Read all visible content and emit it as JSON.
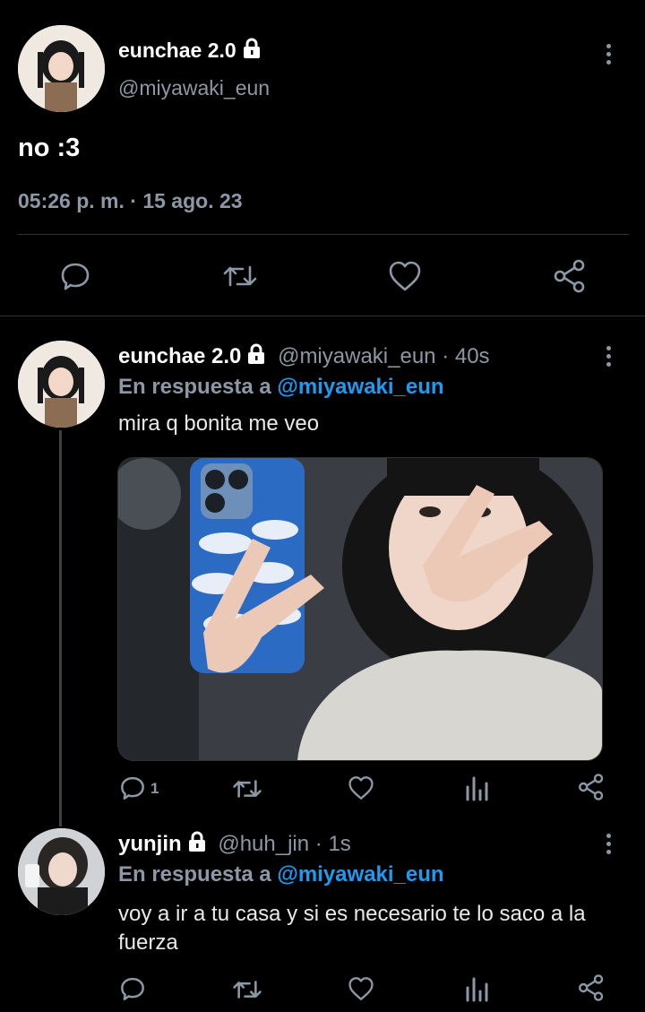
{
  "main_tweet": {
    "display_name": "eunchae 2.0",
    "handle": "@miyawaki_eun",
    "text": "no :3",
    "timestamp": "05:26 p. m. · 15 ago. 23"
  },
  "replies": [
    {
      "display_name": "eunchae 2.0",
      "handle": "@miyawaki_eun",
      "time": "· 40s",
      "reply_prefix": "En respuesta a",
      "reply_to": "@miyawaki_eun",
      "text": "mira q bonita me veo",
      "reply_count": "1",
      "has_image": true
    },
    {
      "display_name": "yunjin",
      "handle": "@huh_jin",
      "time": "· 1s",
      "reply_prefix": "En respuesta a",
      "reply_to": "@miyawaki_eun",
      "text": "voy a ir a tu casa y si es necesario te lo saco a la fuerza"
    }
  ],
  "colors": {
    "background": "#000000",
    "text": "#e7e9ea",
    "muted": "#8b98a5",
    "link": "#1d9bf0",
    "divider": "#2f3336"
  },
  "icons": [
    "lock-icon",
    "more-icon",
    "reply-icon",
    "retweet-icon",
    "like-icon",
    "share-icon",
    "analytics-icon"
  ]
}
